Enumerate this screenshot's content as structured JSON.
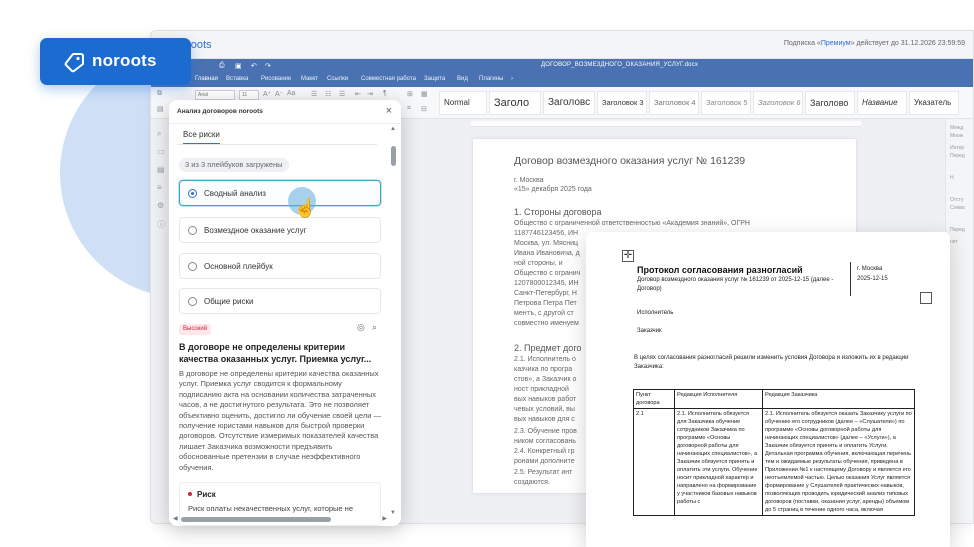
{
  "brand": {
    "name": "noroots",
    "logo": "noroots-logo-icon"
  },
  "editor": {
    "app_name": "oroots",
    "subscription_prefix": "Подписка «",
    "subscription_link": "Премиум",
    "subscription_suffix": "» действует до 31.12.2026 23:59:59",
    "doc_title": "ДОГОВОР_ВОЗМЕЗДНОГО_ОКАЗАНИЯ_УСЛУГ.docx",
    "menu": [
      "Главная",
      "Вставка",
      "Рисование",
      "Макет",
      "Ссылки",
      "Совместная работа",
      "Защита",
      "Вид",
      "Плагины",
      "›"
    ],
    "font_name": "Arial",
    "font_size": "11",
    "styles": [
      "Normal",
      "Заголо",
      "Заголовс",
      "Заголовок 3",
      "Заголовок 4",
      "Заголовок 5",
      "Заголовок 6",
      "Заголово",
      "Название",
      "Указатель"
    ],
    "right_panel": [
      "Межд",
      "Множ",
      "Интер",
      "Перед",
      "Н",
      "Отсту",
      "Слева",
      "Перед",
      "нет"
    ]
  },
  "document": {
    "title": "Договор возмездного оказания услуг № 161239",
    "city": "г. Москва",
    "date": "«15» декабря 2025 года",
    "section1": "1. Стороны договора",
    "s1_lines": [
      "Общество с ограниченной ответственностью «Академия знаний», ОГРН",
      "1187746123456, ИН",
      "Москва, ул. Мясниц",
      "Ивана Ивановича, д",
      "ной стороны, и",
      "Общество с огранич",
      "1207800012345, ИН",
      "Санкт-Петербург, Н",
      "Петрова Петра Пет",
      "ментъ, с другой ст",
      "совместно именуем"
    ],
    "section2": "2. Предмет дого",
    "s2_lines": [
      "2.1. Исполнитель о",
      "казчика по програ",
      "стов», а Заказчик о",
      "ност прикладной",
      "вых навыков работ",
      "чевых условий, вы",
      "вых навыков для с",
      "2.3. Обучение пров",
      "ником согласовань",
      "2.4. Конкретный гр",
      "ронами дополните",
      "2.5. Результат инт",
      "создаются."
    ]
  },
  "protocol": {
    "title": "Протокол согласования разногласий",
    "subtitle": "Договор возмездного оказания услуг № 161239 от 2025-12-15 (далее - Договор)",
    "city": "г. Москва",
    "date": "2025-12-15",
    "executor": "Исполнитель",
    "customer": "Заказчик",
    "intro": "В целях согласования разногласий решили изменить условия Договора и изложить их в редакции Заказчика:",
    "table_headers": [
      "Пункт договора",
      "Редакция Исполнителя",
      "Редакция Заказчика"
    ],
    "row_num": "2.1",
    "row_exec": "2.1. Исполнитель обязуется для Заказчика обучение сотрудников Заказчика по программе «Основы договорной работы для начинающих специалистов», а Заказчик обязуется принять и оплатить эти услуги. Обучение носит прикладной характер и направлено на формирование у участников базовых навыков работы с",
    "row_cust": "2.1. Исполнитель обязуется оказать Заказчику услуги по обучению его сотрудников (далее – «Слушатели») по программе «Основы договорной работы для начинающих специалистов» (далее – «Услуги»), а Заказчик обязуется принять и оплатить Услуги. Детальная программа обучения, включающая перечень тем и ожидаемые результаты обучения, приведена в Приложении №1 к настоящему Договору и является его неотъемлемой частью. Целью оказания Услуг является формирование у Слушателей практических навыков, позволяющих проводить юридический анализ типовых договоров (поставки, оказания услуг, аренды) объемом до 5 страниц в течение одного часа, включая"
  },
  "panel": {
    "title": "Анализ договоров noroots",
    "tab": "Все риски",
    "loaded": "3 из 3 плейбуков загружены",
    "options": [
      "Сводный анализ",
      "Возмездное оказание услуг",
      "Основной плейбук",
      "Общие риски"
    ],
    "severity": "Высокий",
    "risk_title": "В договоре не определены критерии качества оказанных услуг. Приемка услуг...",
    "risk_body": "В договоре не определены критерии качества оказанных услуг. Приемка услуг сводится к формальному подписанию акта на основании количества затраченных часов, а не достигнутого результата. Это не позволяет объективно оценить, достигло ли обучение своей цели — получение юристами навыков для быстрой проверки договоров. Отсутствие измеримых показателей качества лишает Заказчика возможности предъявить обоснованные претензии в случае неэффективного обучения.",
    "card_title": "Риск",
    "card_body": "Риск оплаты некачественных услуг, которые не"
  },
  "colors": {
    "brand": "#1b6bd1",
    "toolbar": "#4a72b3",
    "risk_high": "#c8283a",
    "selected": "#3aa6c8"
  }
}
